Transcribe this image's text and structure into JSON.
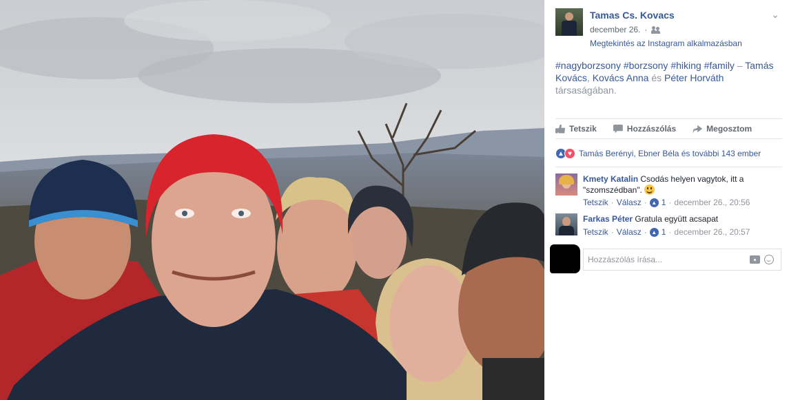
{
  "post": {
    "author": "Tamas Cs. Kovacs",
    "date": "december 26.",
    "audience_icon": "friends-icon",
    "instagram_link": "Megtekintés az Instagram alkalmazásban",
    "caption": {
      "tags": "#nagyborzsony #borzsony #hiking #family",
      "dash": " – ",
      "person1": "Tamás Kovács",
      "sep1": ", ",
      "person2": "Kovács Anna",
      "and": " és ",
      "person3": "Péter Horváth",
      "suffix": " társaságában."
    }
  },
  "actions": {
    "like": "Tetszik",
    "comment": "Hozzászólás",
    "share": "Megosztom"
  },
  "reactions": {
    "summary": "Tamás Berényi, Ebner Béla és további 143 ember"
  },
  "comments": [
    {
      "name": "Kmety Katalin",
      "text": "Csodás helyen vagytok, itt a \"szomszédban\".",
      "like": "Tetszik",
      "reply": "Válasz",
      "likes": "1",
      "time": "december 26., 20:56"
    },
    {
      "name": "Farkas Péter",
      "text": "Gratula együtt acsapat",
      "like": "Tetszik",
      "reply": "Válasz",
      "likes": "1",
      "time": "december 26., 20:57"
    }
  ],
  "composer": {
    "placeholder": "Hozzászólás írása..."
  },
  "colors": {
    "link": "#365899",
    "muted": "#90949c",
    "like_blue": "#4267b2",
    "love_red": "#f25268"
  }
}
